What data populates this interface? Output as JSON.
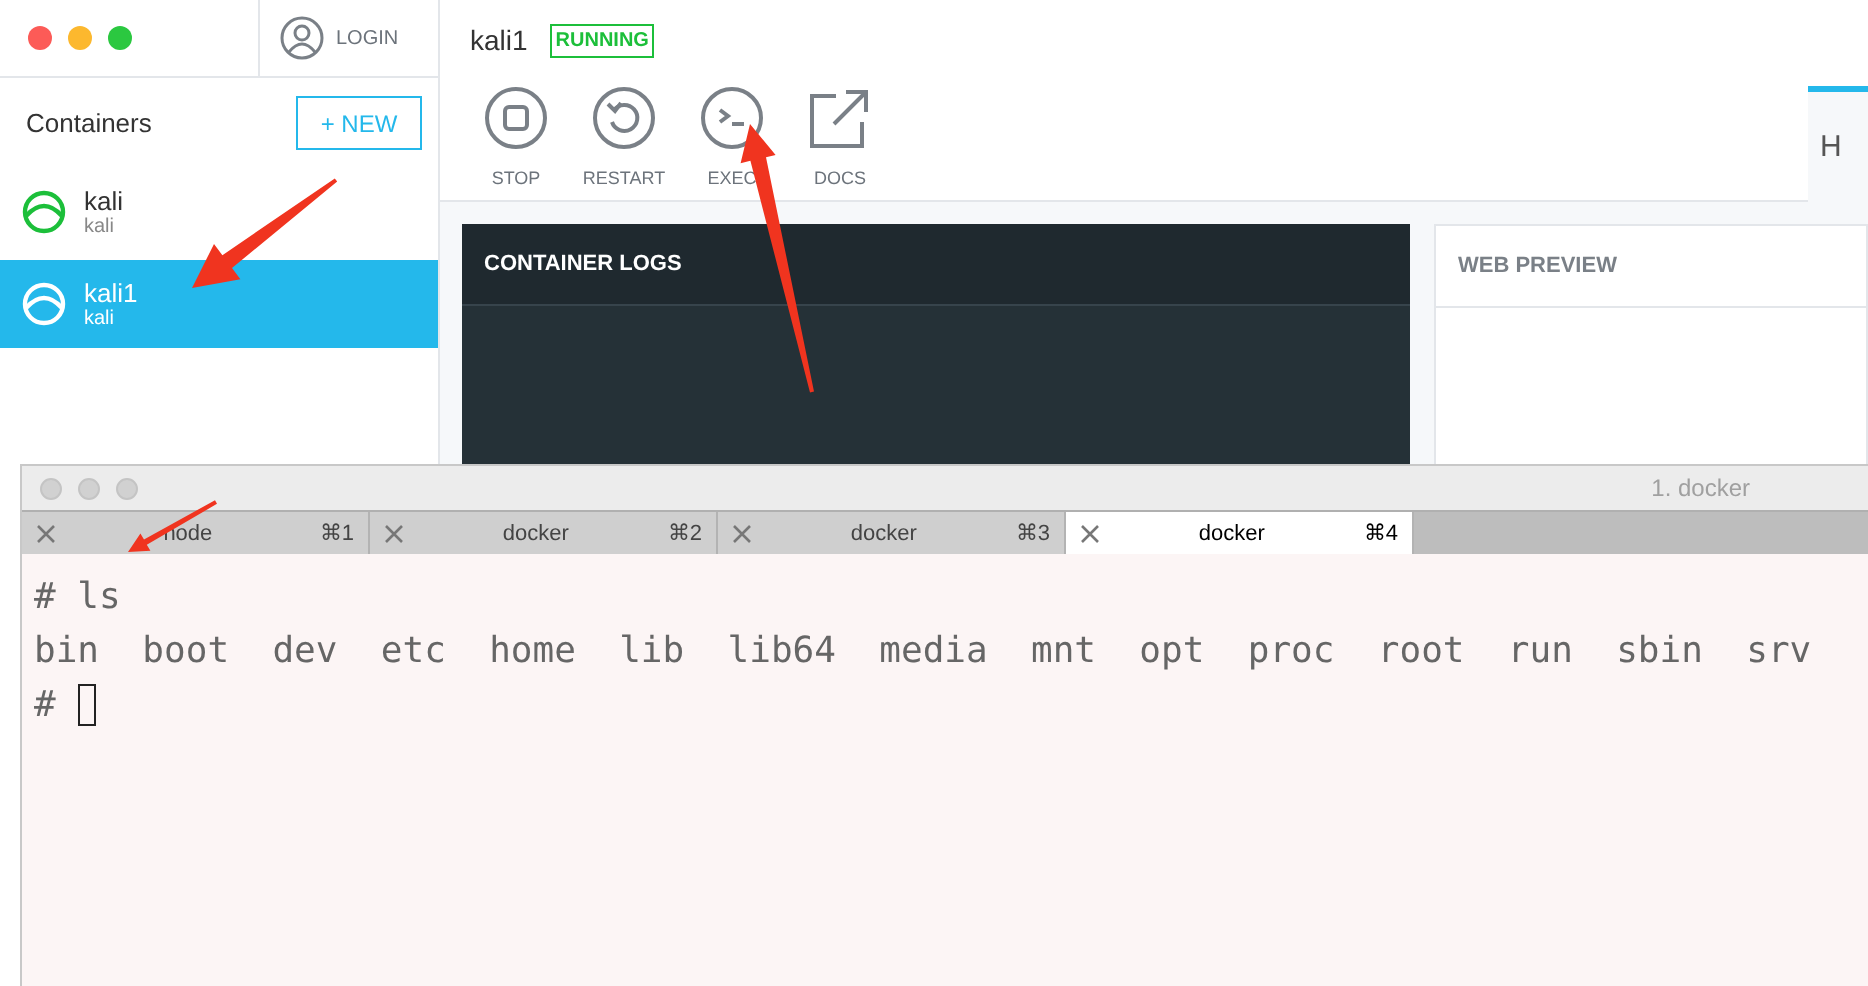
{
  "sidebar": {
    "login": "LOGIN",
    "heading": "Containers",
    "new_button": "+ NEW",
    "containers": [
      {
        "name": "kali",
        "image": "kali",
        "selected": false
      },
      {
        "name": "kali1",
        "image": "kali",
        "selected": true
      }
    ]
  },
  "container": {
    "name": "kali1",
    "status": "RUNNING",
    "actions": [
      {
        "kind": "stop",
        "label": "STOP"
      },
      {
        "kind": "restart",
        "label": "RESTART"
      },
      {
        "kind": "exec",
        "label": "EXEC"
      },
      {
        "kind": "docs",
        "label": "DOCS"
      }
    ],
    "tabs": [
      {
        "label": "H",
        "selected": true
      }
    ],
    "panels": [
      {
        "kind": "dark",
        "title": "CONTAINER LOGS"
      },
      {
        "kind": "light",
        "title": "WEB PREVIEW"
      }
    ]
  },
  "terminal": {
    "title": "1. docker",
    "tabs": [
      {
        "label": "node",
        "shortcut": "⌘1",
        "selected": false
      },
      {
        "label": "docker",
        "shortcut": "⌘2",
        "selected": false
      },
      {
        "label": "docker",
        "shortcut": "⌘3",
        "selected": false
      },
      {
        "label": "docker",
        "shortcut": "⌘4",
        "selected": true
      }
    ],
    "lines": [
      {
        "text": "# ls",
        "cursor": false
      },
      {
        "text": "bin  boot  dev  etc  home  lib  lib64  media  mnt  opt  proc  root  run  sbin  srv",
        "cursor": false
      },
      {
        "text": "# ",
        "cursor": true
      }
    ]
  }
}
